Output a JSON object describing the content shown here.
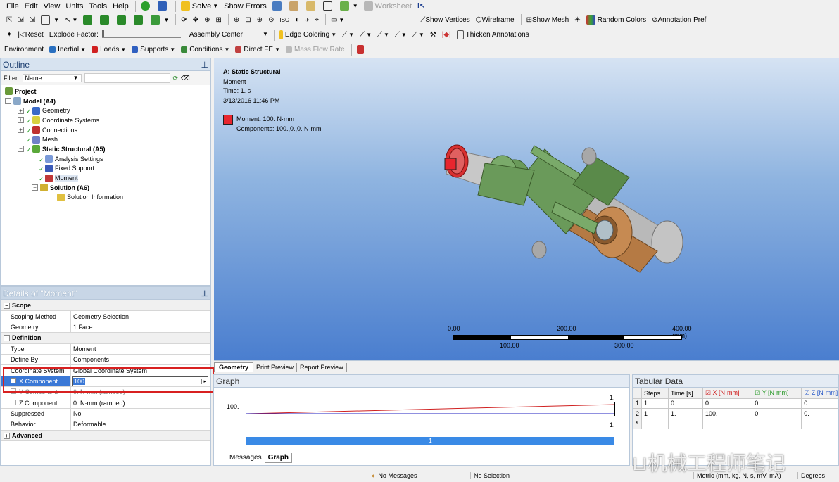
{
  "menu": [
    "File",
    "Edit",
    "View",
    "Units",
    "Tools",
    "Help"
  ],
  "toolbar1": {
    "solve": "Solve",
    "show_errors": "Show Errors",
    "worksheet": "Worksheet"
  },
  "toolbar2": {
    "show_vertices": "Show Vertices",
    "wireframe": "Wireframe",
    "show_mesh": "Show Mesh",
    "random_colors": "Random Colors",
    "annotation_prefs": "Annotation Pref"
  },
  "toolbar3": {
    "reset": "Reset",
    "explode_factor": "Explode Factor:",
    "assembly_center": "Assembly Center",
    "edge_coloring": "Edge Coloring",
    "thicken": "Thicken Annotations"
  },
  "toolbar4": {
    "environment": "Environment",
    "inertial": "Inertial",
    "loads": "Loads",
    "supports": "Supports",
    "conditions": "Conditions",
    "direct_fe": "Direct FE",
    "mass_flow": "Mass Flow Rate"
  },
  "outline": {
    "title": "Outline",
    "filter_label": "Filter:",
    "filter_value": "Name",
    "tree": {
      "project": "Project",
      "model": "Model (A4)",
      "geometry": "Geometry",
      "coord": "Coordinate Systems",
      "connections": "Connections",
      "mesh": "Mesh",
      "static": "Static Structural (A5)",
      "analysis": "Analysis Settings",
      "fixed": "Fixed Support",
      "moment": "Moment",
      "solution": "Solution (A6)",
      "solinfo": "Solution Information"
    }
  },
  "details": {
    "title": "Details of \"Moment\"",
    "scope": "Scope",
    "scoping_method_k": "Scoping Method",
    "scoping_method_v": "Geometry Selection",
    "geometry_k": "Geometry",
    "geometry_v": "1 Face",
    "definition": "Definition",
    "type_k": "Type",
    "type_v": "Moment",
    "defineby_k": "Define By",
    "defineby_v": "Components",
    "coord_k": "Coordinate System",
    "coord_v": "Global Coordinate System",
    "x_k": "X Component",
    "x_v": "100",
    "y_k": "Y Component",
    "y_v": "0. N·mm  (ramped)",
    "z_k": "Z Component",
    "z_v": "0. N·mm  (ramped)",
    "supp_k": "Suppressed",
    "supp_v": "No",
    "beh_k": "Behavior",
    "beh_v": "Deformable",
    "advanced": "Advanced"
  },
  "viewport": {
    "title": "A: Static Structural",
    "sub": "Moment",
    "time": "Time: 1. s",
    "date": "3/13/2016 11:46 PM",
    "legend1": "Moment: 100. N·mm",
    "legend2": "Components: 100.,0.,0. N·mm",
    "legend_color": "#e8262e",
    "scale": {
      "t0": "0.00",
      "t200": "200.00",
      "t400": "400.00 (mm)",
      "t100": "100.00",
      "t300": "300.00"
    }
  },
  "viewtabs": [
    "Geometry",
    "Print Preview",
    "Report Preview"
  ],
  "graph": {
    "title": "Graph",
    "y": "100.",
    "right_top": "1.",
    "right_bot": "1.",
    "step": "1",
    "tabs": [
      "Messages",
      "Graph"
    ]
  },
  "tabular": {
    "title": "Tabular Data",
    "cols": [
      "Steps",
      "Time [s]",
      "X [N·mm]",
      "Y [N·mm]",
      "Z [N·mm]"
    ],
    "rows": [
      [
        "1",
        "1",
        "0.",
        "0.",
        "0.",
        "0."
      ],
      [
        "2",
        "1",
        "1.",
        "100.",
        "0.",
        "0."
      ]
    ],
    "new_row": "*"
  },
  "status": {
    "messages": "No Messages",
    "selection": "No Selection",
    "units": "Metric (mm, kg, N, s, mV, mA)",
    "angle": "Degrees"
  },
  "watermark": "机械工程师笔记"
}
